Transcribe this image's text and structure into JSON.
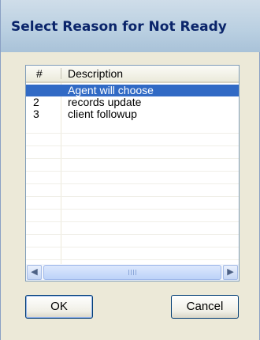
{
  "dialog": {
    "title": "Select Reason for Not Ready"
  },
  "list": {
    "columns": [
      "#",
      "Description"
    ],
    "rows": [
      {
        "num": "",
        "description": "Agent will choose",
        "selected": true
      },
      {
        "num": "2",
        "description": "records update",
        "selected": false
      },
      {
        "num": "3",
        "description": "client followup",
        "selected": false
      }
    ]
  },
  "scrollbar": {
    "left_arrow": "◀",
    "right_arrow": "▶"
  },
  "buttons": {
    "ok_label": "OK",
    "cancel_label": "Cancel"
  },
  "colors": {
    "selection": "#316ac5",
    "title_text": "#0a246a"
  }
}
